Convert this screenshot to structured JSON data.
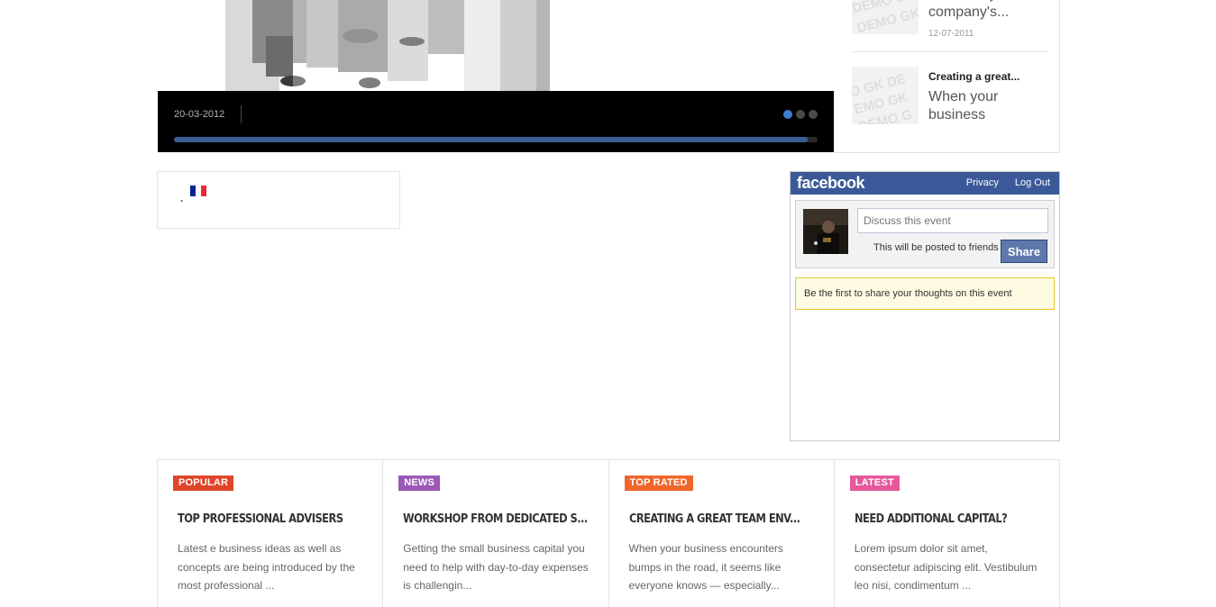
{
  "slider": {
    "date": "20-03-2012",
    "progress_percent": 98.5,
    "dots": [
      true,
      false,
      false
    ]
  },
  "news": [
    {
      "title_line": "Describe your company's...",
      "date": "12-07-2011"
    },
    {
      "title_small": "Creating a great...",
      "title_big": "When your business"
    }
  ],
  "language": {
    "separator": ".",
    "flag": "france-flag",
    "flag_colors": [
      "#002395",
      "#ffffff",
      "#ed2939"
    ]
  },
  "facebook": {
    "logo": "facebook",
    "links": [
      "Privacy",
      "Log Out"
    ],
    "input_placeholder": "Discuss this event",
    "note": "This will be posted to friends",
    "share_label": "Share",
    "empty_message": "Be the first to share your thoughts on this event"
  },
  "cards": [
    {
      "badge": "POPULAR",
      "badge_color": "#e0452a",
      "title": "Top Professional Advisers",
      "text": "Latest e business ideas as well as concepts are being introduced by the most professional ..."
    },
    {
      "badge": "NEWS",
      "badge_color": "#9b59b6",
      "title": "Workshop from dedicated s...",
      "text": "Getting the small business capital you need to help with day-to-day expenses is challengin..."
    },
    {
      "badge": "TOP RATED",
      "badge_color": "#f0662a",
      "title": "Creating a great team env...",
      "text": "When your business encounters bumps in the road, it seems like everyone knows — especially..."
    },
    {
      "badge": "LATEST",
      "badge_color": "#e5589c",
      "title": "Need additional capital?",
      "text": "Lorem ipsum dolor sit amet, consectetur adipiscing elit. Vestibulum leo nisi, condimentum ..."
    }
  ]
}
